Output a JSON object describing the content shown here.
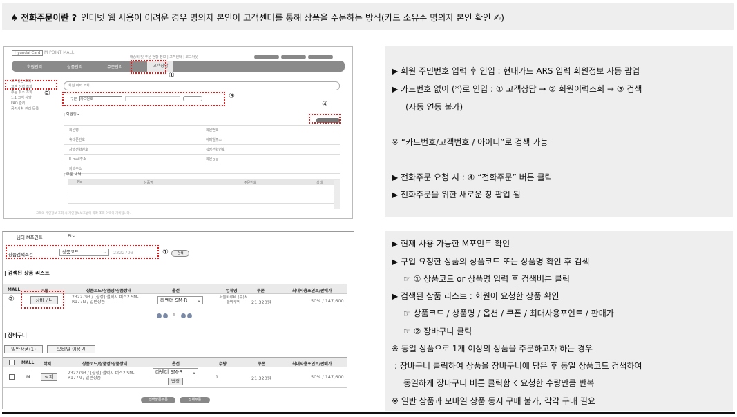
{
  "header": {
    "title": "♠ 전화주문이란 ?",
    "description": "인터넷 웹 사용이 어려운 경우 명의자 본인이 고객센터를 통해 상품을 주문하는 방식(카드 소유주 명의자 본인 확인 ✍)"
  },
  "screen1": {
    "logo": "Hyundai Card",
    "logo2": "M POINT MALL",
    "toplinks": "배송비 및 주문 현황 정보 | 고객센터 | 로그아웃",
    "nav": [
      "회원관리",
      "상품관리",
      "주문관리",
      "고객상담"
    ],
    "side": [
      "고객상담 조회",
      "고객 이력 조회",
      "주문 취소 조회",
      "1:1 고객 상담",
      "FAQ 관리",
      "공지사항 관리 목록"
    ],
    "search_title": "회원 이력 조회",
    "search_select": "카드번호",
    "section_info": "| 회원정보",
    "section_list": "| 주문 내역",
    "info_left": [
      "회원명",
      "휴대폰번호",
      "자택전화번호",
      "E-mail주소",
      "자택주소"
    ],
    "info_right": [
      "회원번호",
      "이메일주소",
      "직장전화번호",
      "회원등급"
    ],
    "list_headers": [
      "No",
      "상품명",
      "주문번호",
      "상태"
    ],
    "footer": "고객의 개인정보 조회 시 개인정보보호법에 따라 조회 이력이 기록됩니다."
  },
  "screen2": {
    "mpoint_label": "님의 M포인트",
    "pts": "Pts",
    "search_label": "상품검색조건",
    "search_select": "상품코드",
    "search_input": "2322793",
    "search_button": "검색",
    "section_result": "| 검색된 상품 리스트",
    "result_headers": [
      "MALL",
      "이동",
      "상품코드/상품명/상품상태",
      "옵션",
      "업체명",
      "쿠폰",
      "최대사용포인트/판매가"
    ],
    "result_row": {
      "cart_button": "장바구니",
      "product": "2322793 / [삼성] 갤럭시 버즈2 SM-R177N / 일반상품",
      "option": "라벤더 SM-R",
      "vendor": "서울바루비 (주)서울바루비",
      "coupon": "21,320원",
      "price": "50% / 147,600"
    },
    "section_cart": "| 장바구니",
    "cart_tabs": [
      "일반상품(1)",
      "모바일 이용권"
    ],
    "cart_headers": [
      "MALL",
      "삭제",
      "상품코드/상품명/상품상태",
      "옵션",
      "수량",
      "쿠폰",
      "최대사용포인트/판매가"
    ],
    "cart_row": {
      "mall": "M",
      "delete_button": "삭제",
      "product": "2322793 / [삼성] 갤럭시 버즈2 SM-R177N / 일반상품",
      "option": "라벤더 SM-R",
      "change_button": "변경",
      "qty": "1",
      "coupon": "21,320원",
      "price": "50% / 147,600"
    },
    "bottom_buttons": [
      "선택상품주문",
      "전체주문"
    ]
  },
  "markers": [
    "①",
    "②",
    "③",
    "④"
  ],
  "panel1": {
    "lines": [
      "▶ 회원 주민번호 입력 후 인입 : 현대카드 ARS 입력 회원정보 자동 팝업",
      "▶ 카드번호 없이 (*)로 인입 : ① 고객상담 → ② 회원이력조회 → ③ 검색",
      "(자동 연동 불가)",
      "※ “카드번호/고객번호 / 아이디”로 검색 가능",
      "▶ 전화주문 요청 시 : ④ “전화주문” 버튼 클릭",
      "▶ 전화주문을 위한 새로운 창 팝업 됨"
    ]
  },
  "panel2": {
    "lines": [
      "▶ 현재 사용 가능한 M포인트 확인",
      "▶ 구입 요청한 상품의 상품코드 또는 상품명 확인 후 검색",
      "☞ ① 상품코드 or 상품명 입력 후 검색버튼 클릭",
      "▶ 검색된 상품 리스트 : 회원이 요청한 상품 확인",
      "☞ 상품코드 / 상품명 / 옵션 / 쿠폰 / 최대사용포인트 / 판매가",
      "☞ ② 장바구니 클릭",
      "※ 동일 상품으로 1개 이상의 상품을 주문하고자 하는 경우",
      ": 장바구니 클릭하여 상품을 장바구니에 담은 후 동일 상품코드 검색하여",
      "※ 일반 상품과 모바일 상품 동시 구매 불가, 각각 구매 필요"
    ],
    "line_underline_prefix": "동일하게 장바구니 버튼 클릭함 ☇ ",
    "line_underline_text": "요청한 수량만큼 반복"
  }
}
